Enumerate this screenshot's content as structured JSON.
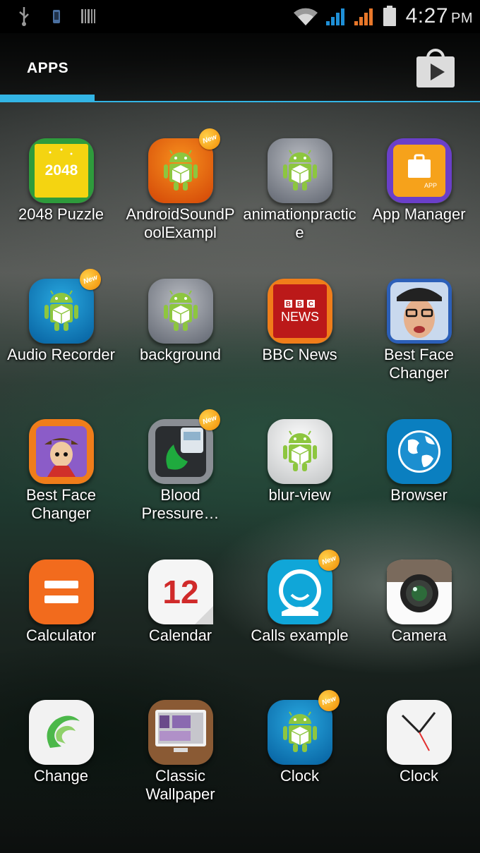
{
  "status_bar": {
    "time": "4:27",
    "ampm": "PM",
    "icons": [
      "usb-icon",
      "phone-icon",
      "barcode-icon",
      "wifi-icon",
      "signal-blue-icon",
      "signal-orange-icon",
      "battery-icon"
    ]
  },
  "tabs": {
    "apps_label": "APPS",
    "store_icon": "play-store-icon"
  },
  "colors": {
    "accent": "#33b5e5",
    "badge": "#f5a300"
  },
  "apps": [
    {
      "label": "2048 Puzzle",
      "icon": "puzzle-2048-icon",
      "icon_text": "2048",
      "new": false
    },
    {
      "label": "AndroidSoundPoolExampl",
      "icon": "android-robot-icon",
      "new": true
    },
    {
      "label": "animationpractice",
      "icon": "android-robot-icon",
      "new": false
    },
    {
      "label": "App Manager",
      "icon": "app-manager-icon",
      "icon_text": "APP",
      "new": false
    },
    {
      "label": "Audio Recorder",
      "icon": "android-robot-icon",
      "new": true
    },
    {
      "label": "background",
      "icon": "android-robot-icon",
      "new": false
    },
    {
      "label": "BBC News",
      "icon": "bbc-news-icon",
      "icon_text": "BBC NEWS",
      "new": false
    },
    {
      "label": "Best Face Changer",
      "icon": "face-photo-icon",
      "new": false
    },
    {
      "label": "Best Face Changer",
      "icon": "face-cartoon-icon",
      "new": false
    },
    {
      "label": "Blood Pressure…",
      "icon": "blood-pressure-icon",
      "new": true
    },
    {
      "label": "blur-view",
      "icon": "android-robot-icon",
      "new": false
    },
    {
      "label": "Browser",
      "icon": "globe-icon",
      "new": false
    },
    {
      "label": "Calculator",
      "icon": "calculator-icon",
      "new": false
    },
    {
      "label": "Calendar",
      "icon": "calendar-icon",
      "icon_text": "12",
      "new": false
    },
    {
      "label": "Calls example",
      "icon": "contact-face-icon",
      "new": true
    },
    {
      "label": "Camera",
      "icon": "camera-lens-icon",
      "new": false
    },
    {
      "label": "Change",
      "icon": "swirl-icon",
      "new": false
    },
    {
      "label": "Classic Wallpaper",
      "icon": "wallpaper-monitor-icon",
      "new": false
    },
    {
      "label": "Clock",
      "icon": "android-robot-icon",
      "new": true
    },
    {
      "label": "Clock",
      "icon": "clock-icon",
      "new": false
    }
  ],
  "badge_text": "New"
}
